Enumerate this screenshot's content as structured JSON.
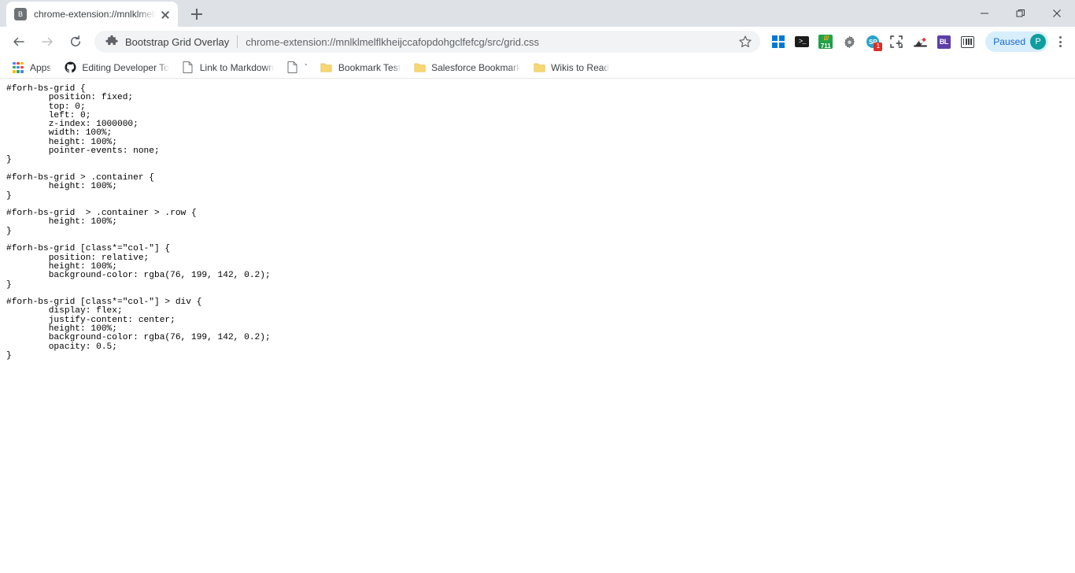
{
  "window": {
    "minimize_label": "minimize-window",
    "maximize_label": "restore-window",
    "close_label": "close-window"
  },
  "tabstrip": {
    "tabs": [
      {
        "favicon_letter": "B",
        "title": "chrome-extension://mnlklmelflkh",
        "close_label": "close-tab"
      }
    ],
    "new_tab_label": "+"
  },
  "toolbar": {
    "back_label": "Back",
    "forward_label": "Forward",
    "reload_label": "Reload",
    "omnibox": {
      "extension_name": "Bootstrap Grid Overlay",
      "url": "chrome-extension://mnlklmelflkheijccafopdohgclfefcg/src/grid.css",
      "bookmark_star_label": "Bookmark this tab"
    },
    "extensions": [
      {
        "name": "windows-icon",
        "kind": "win",
        "badge": ""
      },
      {
        "name": "terminal-icon",
        "kind": "term",
        "glyph": ">_",
        "badge": ""
      },
      {
        "name": "seven-eleven-icon",
        "kind": "711",
        "top": "ᗯ",
        "bottom": "711",
        "badge": ""
      },
      {
        "name": "gear-icon",
        "kind": "gear",
        "badge": ""
      },
      {
        "name": "scrapbook-icon",
        "kind": "sp",
        "glyph": "SP",
        "badge": "1"
      },
      {
        "name": "screenshot-crop-icon",
        "kind": "crop",
        "badge": ""
      },
      {
        "name": "ink-marker-icon",
        "kind": "draw",
        "badge": ""
      },
      {
        "name": "bl-extension-icon",
        "kind": "bl",
        "glyph": "BL",
        "badge": ""
      },
      {
        "name": "barcode-icon",
        "kind": "bars",
        "badge": ""
      }
    ],
    "profile": {
      "status": "Paused",
      "avatar_letter": "P",
      "accent_color": "#d7eefc",
      "text_color": "#1967d2",
      "avatar_color": "#0f9d9d"
    },
    "menu_label": "Customize and control Google Chrome"
  },
  "bookmarks_bar": {
    "items": [
      {
        "label": "Apps",
        "icon": "apps-grid-icon"
      },
      {
        "label": "Editing Developer To",
        "icon": "github-icon"
      },
      {
        "label": "Link to Markdown",
        "icon": "document-icon"
      },
      {
        "label": "`",
        "icon": "document-icon"
      },
      {
        "label": "Bookmark Test",
        "icon": "folder-icon"
      },
      {
        "label": "Salesforce Bookmarks",
        "icon": "folder-icon"
      },
      {
        "label": "Wikis to Read",
        "icon": "folder-icon"
      }
    ]
  },
  "page_content": {
    "mime": "text/css",
    "source": "#forh-bs-grid {\n        position: fixed;\n        top: 0;\n        left: 0;\n        z-index: 1000000;\n        width: 100%;\n        height: 100%;\n        pointer-events: none;\n}\n\n#forh-bs-grid > .container {\n        height: 100%;\n}\n\n#forh-bs-grid  > .container > .row {\n        height: 100%;\n}\n\n#forh-bs-grid [class*=\"col-\"] {\n        position: relative;\n        height: 100%;\n        background-color: rgba(76, 199, 142, 0.2);\n}\n\n#forh-bs-grid [class*=\"col-\"] > div {\n        display: flex;\n        justify-content: center;\n        height: 100%;\n        background-color: rgba(76, 199, 142, 0.2);\n        opacity: 0.5;\n}"
  }
}
